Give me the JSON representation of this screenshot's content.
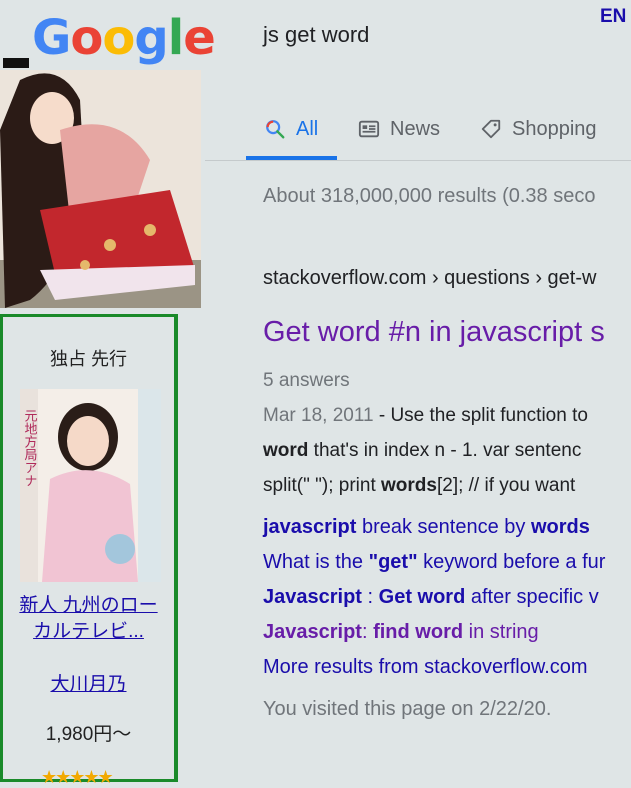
{
  "logo": {
    "g1": "G",
    "o1": "o",
    "o2": "o",
    "g2": "g",
    "l": "l",
    "e": "e"
  },
  "lang": "EN",
  "search": {
    "query": "js get word"
  },
  "tabs": [
    {
      "label": "All",
      "icon": "search-icon"
    },
    {
      "label": "News",
      "icon": "news-icon"
    },
    {
      "label": "Shopping",
      "icon": "tag-icon"
    }
  ],
  "ad": {
    "header": "独占 先行",
    "product_title_line1": "新人 九州のロー",
    "product_title_line2": "カルテレビ...",
    "actress": "大川月乃",
    "price": "1,980円～",
    "stars": "★★★★★"
  },
  "results": {
    "stats": "About 318,000,000 results (0.38 seco",
    "breadcrumb": "stackoverflow.com › questions › get-w",
    "title": "Get word #n in javascript s",
    "answers": "5 answers",
    "snippet": {
      "date": "Mar 18, 2011",
      "line1_rest": " - Use the split function to",
      "line2_bold": "word",
      "line2_rest": " that's in index n - 1. var sentenc",
      "line3_a": "split(\" \"); print ",
      "line3_bold": "words",
      "line3_b": "[2]; // if you want"
    },
    "sublinks": [
      {
        "parts": [
          [
            "javascript",
            true
          ],
          [
            " break sentence by ",
            false
          ],
          [
            "words",
            true
          ]
        ],
        "visited": false
      },
      {
        "parts": [
          [
            "What is the ",
            false
          ],
          [
            "\"get\"",
            true
          ],
          [
            " keyword before a fur",
            false
          ]
        ],
        "visited": false
      },
      {
        "parts": [
          [
            "Javascript",
            true
          ],
          [
            " : ",
            false
          ],
          [
            "Get word",
            true
          ],
          [
            " after specific v",
            false
          ]
        ],
        "visited": false
      },
      {
        "parts": [
          [
            "Javascript",
            true
          ],
          [
            ": ",
            false
          ],
          [
            "find word",
            true
          ],
          [
            " in string",
            false
          ]
        ],
        "visited": true
      },
      {
        "parts": [
          [
            "More results from stackoverflow.com",
            false
          ]
        ],
        "visited": false
      }
    ],
    "visited_note": "You visited this page on 2/22/20."
  },
  "colors": {
    "brand_blue": "#4285F4",
    "link": "#1a0dab",
    "visited": "#681da8",
    "ad_border": "#1a8a2a"
  }
}
